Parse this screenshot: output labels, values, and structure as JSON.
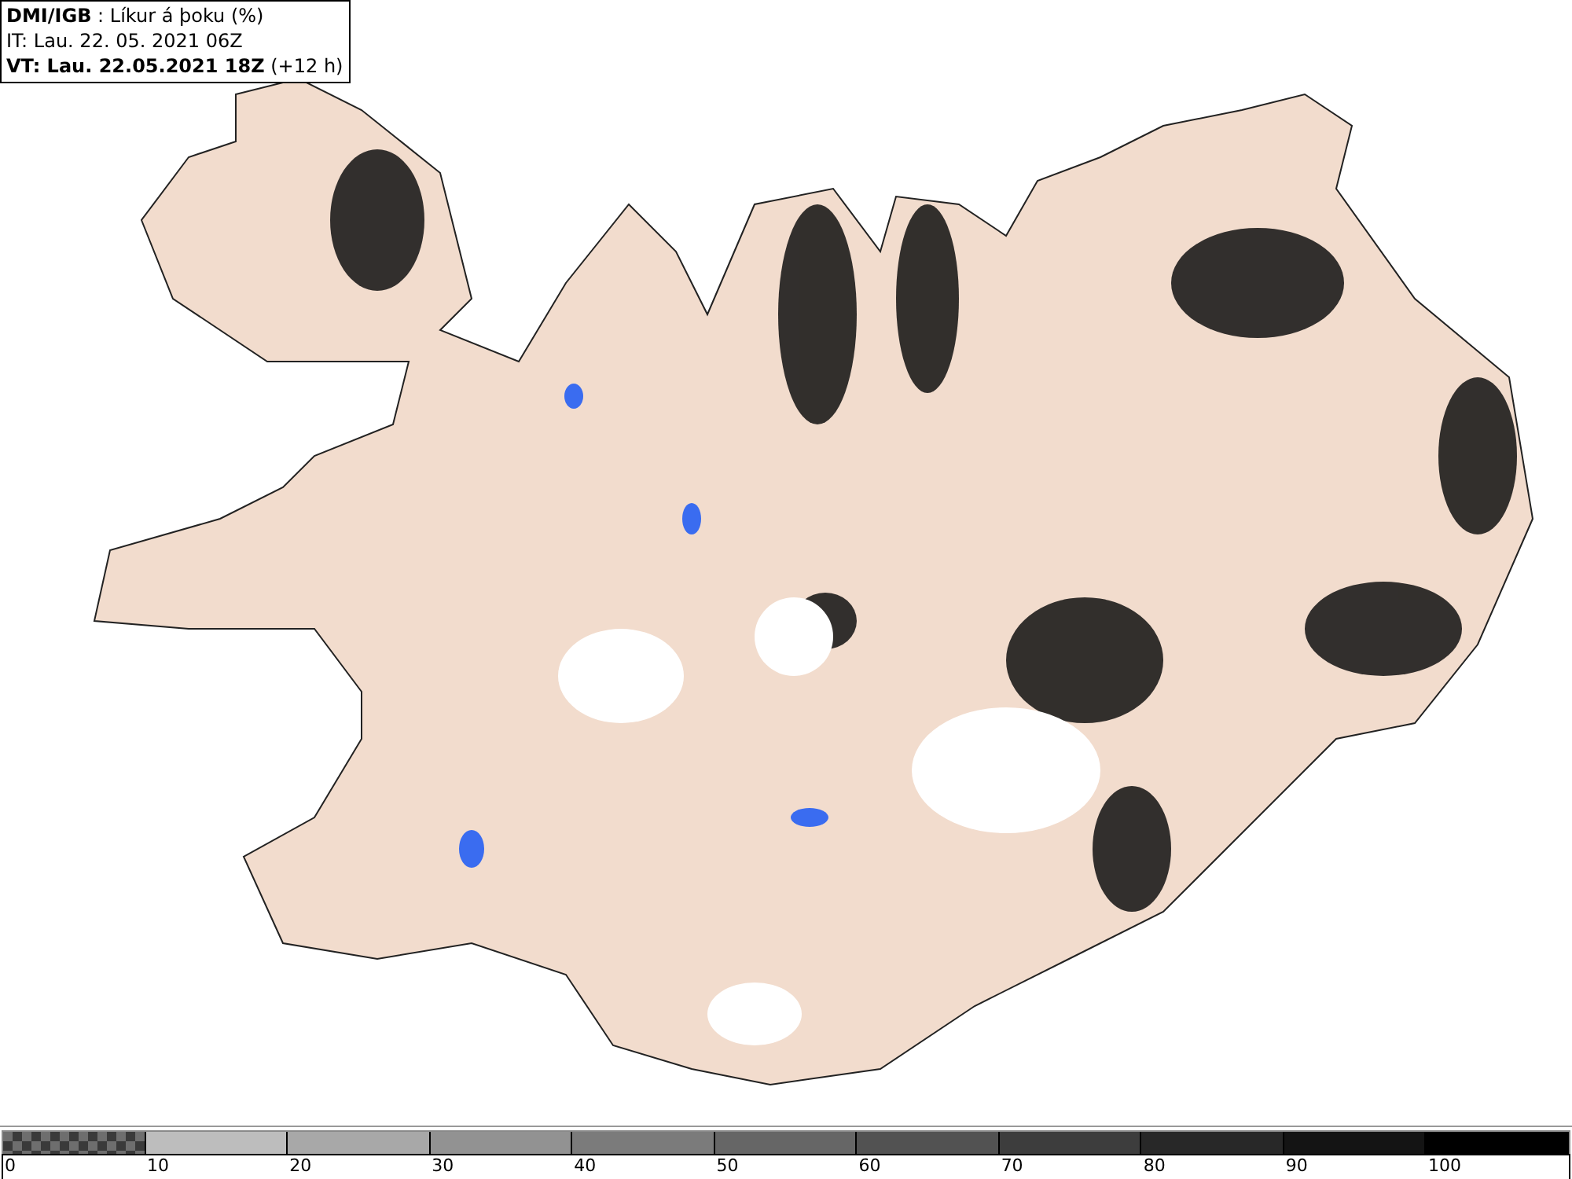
{
  "header": {
    "title": "**DMI/IGB** : Líkur á þoku (%)",
    "issue_time": "IT: Lau. 22. 05. 2021 06Z",
    "valid_time": "**VT: Lau. 22.05.2021 18Z** (+12 h)"
  },
  "legend": {
    "bins": [
      {
        "kind": "checker",
        "color": "#6e6e6e",
        "label": "0"
      },
      {
        "kind": "solid",
        "color": "#bdbdbd",
        "label": "10"
      },
      {
        "kind": "solid",
        "color": "#a8a8a8",
        "label": "20"
      },
      {
        "kind": "solid",
        "color": "#929292",
        "label": "30"
      },
      {
        "kind": "solid",
        "color": "#7b7b7b",
        "label": "40"
      },
      {
        "kind": "solid",
        "color": "#666666",
        "label": "50"
      },
      {
        "kind": "solid",
        "color": "#525252",
        "label": "60"
      },
      {
        "kind": "solid",
        "color": "#3d3d3d",
        "label": "70"
      },
      {
        "kind": "solid",
        "color": "#282828",
        "label": "80"
      },
      {
        "kind": "solid",
        "color": "#141414",
        "label": "90"
      },
      {
        "kind": "solid",
        "color": "#000000",
        "label": "100"
      }
    ]
  }
}
